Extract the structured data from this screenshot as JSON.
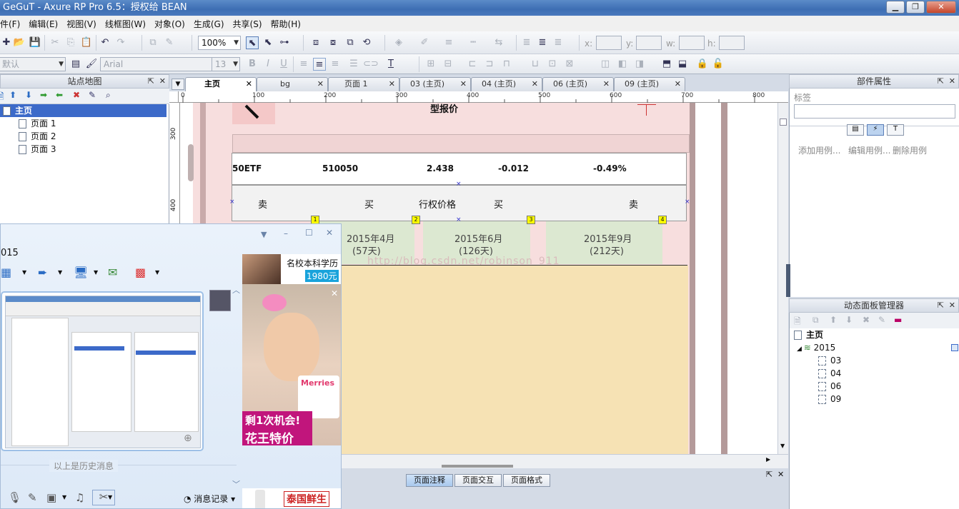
{
  "window": {
    "title": "GeGuT - Axure RP Pro 6.5：授权给 BEAN"
  },
  "menu": [
    "件(F)",
    "编辑(E)",
    "视图(V)",
    "线框图(W)",
    "对象(O)",
    "生成(G)",
    "共享(S)",
    "帮助(H)"
  ],
  "toolbar": {
    "zoom": "100%",
    "coord_x_label": "x:",
    "coord_y_label": "y:",
    "coord_w_label": "w:",
    "coord_h_label": "h:",
    "style_value": "默认",
    "font_value": "Arial",
    "font_size": "13"
  },
  "sitemap": {
    "title": "站点地图",
    "items": [
      {
        "label": "主页"
      },
      {
        "label": "页面 1"
      },
      {
        "label": "页面 2"
      },
      {
        "label": "页面 3"
      }
    ]
  },
  "tabs": [
    {
      "label": "主页"
    },
    {
      "label": "bg"
    },
    {
      "label": "页面 1"
    },
    {
      "label": "03 (主页)"
    },
    {
      "label": "04 (主页)"
    },
    {
      "label": "06 (主页)"
    },
    {
      "label": "09 (主页)"
    }
  ],
  "ruler": {
    "h_ticks": [
      "0",
      "100",
      "200",
      "300",
      "400",
      "500",
      "600",
      "700",
      "800"
    ],
    "v_ticks": [
      "300",
      "400"
    ]
  },
  "canvas": {
    "heading": "型报价",
    "quote": {
      "name": "50ETF",
      "code": "510050",
      "price": "2.438",
      "change": "-0.012",
      "pct": "-0.49%"
    },
    "header_row": {
      "sell_left": "卖",
      "buy_left": "买",
      "strike": "行权价格",
      "buy_right": "买",
      "sell_right": "卖"
    },
    "markers": [
      "1",
      "2",
      "3",
      "4"
    ],
    "months": [
      {
        "date": "2015年4月",
        "days": "(57天)"
      },
      {
        "date": "2015年6月",
        "days": "(126天)"
      },
      {
        "date": "2015年9月",
        "days": "(212天)"
      }
    ],
    "watermark": "http://blog.csdn.net/robinson_911"
  },
  "properties": {
    "title": "部件属性",
    "label_caption": "标签",
    "actions": [
      "添加用例...",
      "编辑用例...",
      "删除用例"
    ]
  },
  "dynamic_panel": {
    "title": "动态面板管理器",
    "root": "主页",
    "panel": "2015",
    "states": [
      "03",
      "04",
      "06",
      "09"
    ]
  },
  "bottom_tabs": [
    {
      "label": "页面注释"
    },
    {
      "label": "页面交互"
    },
    {
      "label": "页面格式"
    }
  ],
  "qq": {
    "title": "015",
    "history_text": "以上是历史消息",
    "record_label": "消息记录",
    "ad1_text": "名校本科学历",
    "ad1_price": "1980元",
    "ad2_line1": "剩1次机会!",
    "ad2_line2": "花王特价",
    "ad2_brand": "Merries",
    "ad3_text": "泰国鲜生"
  }
}
